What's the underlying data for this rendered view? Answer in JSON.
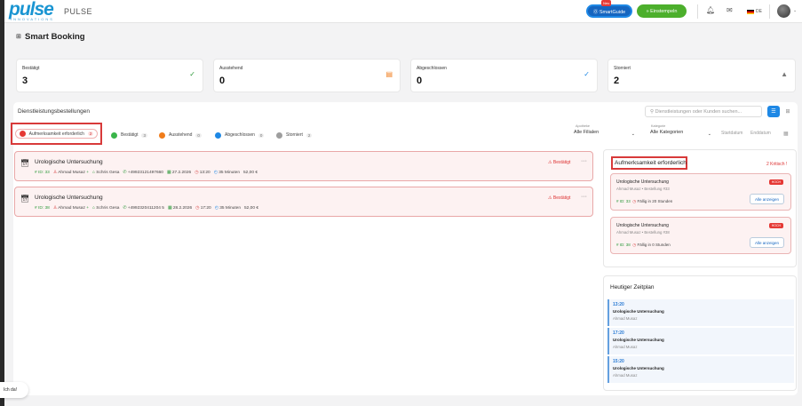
{
  "header": {
    "logo": "pulse",
    "logo_sub": "INNOVATIONS",
    "app_name": "PULSE",
    "new_badge": "Neu",
    "smartguide_label": "⓪ SmartGuide",
    "stamp_label": "» Einstempeln",
    "lang": "DE"
  },
  "page": {
    "title": "Smart Booking"
  },
  "stats": [
    {
      "label": "Bestätigt",
      "value": "3",
      "icon": "check-circle-icon",
      "color": "#2e9a3c"
    },
    {
      "label": "Ausstehend",
      "value": "0",
      "icon": "clipboard-icon",
      "color": "#f07c1a"
    },
    {
      "label": "Abgeschlossen",
      "value": "0",
      "icon": "check-circle-icon",
      "color": "#1e88e5"
    },
    {
      "label": "Storniert",
      "value": "2",
      "icon": "warning-icon",
      "color": "#777777"
    }
  ],
  "section": {
    "title": "Dienstleistungsbestellungen",
    "search_placeholder": "Dienstleistungen oder Kunden suchen..."
  },
  "tabs": [
    {
      "label": "Aufmerksamkeit erforderlich",
      "count": "2",
      "color": "#e53935"
    },
    {
      "label": "Bestätigt",
      "count": "3",
      "color": "#3ab54a"
    },
    {
      "label": "Ausstehend",
      "count": "0",
      "color": "#f07c1a"
    },
    {
      "label": "Abgeschlossen",
      "count": "0",
      "color": "#1e88e5"
    },
    {
      "label": "Storniert",
      "count": "2",
      "color": "#9e9e9e"
    }
  ],
  "filters": {
    "branch_label": "Apotheke",
    "branch_value": "Alle Filialen",
    "category_label": "Kategorie",
    "category_value": "Alle Kategorien",
    "start_date": "Startdatum",
    "end_date": "Enddatum"
  },
  "orders": [
    {
      "title": "Urologische Untersuchung",
      "id": "# ID: 33",
      "customer": "Ahmad Musaz",
      "staff": "Schris Gesa",
      "phone": "+49923121497660",
      "date": "27.2.2026",
      "time": "13:20",
      "duration": "35 Minuten",
      "price": "52,00 €",
      "status": "Bestätigt"
    },
    {
      "title": "Urologische Untersuchung",
      "id": "# ID: 38",
      "customer": "Ahmad Musaz",
      "staff": "Schris Gesa",
      "phone": "+4992320411204 5",
      "date": "28.2.2026",
      "time": "17:20",
      "duration": "35 Minuten",
      "price": "52,00 €",
      "status": "Bestätigt"
    }
  ],
  "attention": {
    "title": "Aufmerksamkeit erforderlich",
    "critical": "2 Kritisch !",
    "items": [
      {
        "title": "Urologische Untersuchung",
        "sub": "Ahmad Musaz • Bestellung #33",
        "id": "# ID: 33",
        "due": "Fällig in 20 Stunden",
        "badge": "HOCH",
        "button": "Alle anzeigen"
      },
      {
        "title": "Urologische Untersuchung",
        "sub": "Ahmad Musaz • Bestellung #38",
        "id": "# ID: 38",
        "due": "Fällig in 0 Stunden",
        "badge": "HOCH",
        "button": "Alle anzeigen"
      }
    ]
  },
  "schedule": {
    "title": "Heutiger Zeitplan",
    "items": [
      {
        "time": "13:20",
        "title": "Urologische Untersuchung",
        "person": "Ahmad Musaz"
      },
      {
        "time": "17:20",
        "title": "Urologische Untersuchung",
        "person": "Ahmad Musaz"
      },
      {
        "time": "15:20",
        "title": "Urologische Untersuchung",
        "person": "Ahmad Musaz"
      }
    ]
  },
  "chat": {
    "label": "Ich da!"
  }
}
